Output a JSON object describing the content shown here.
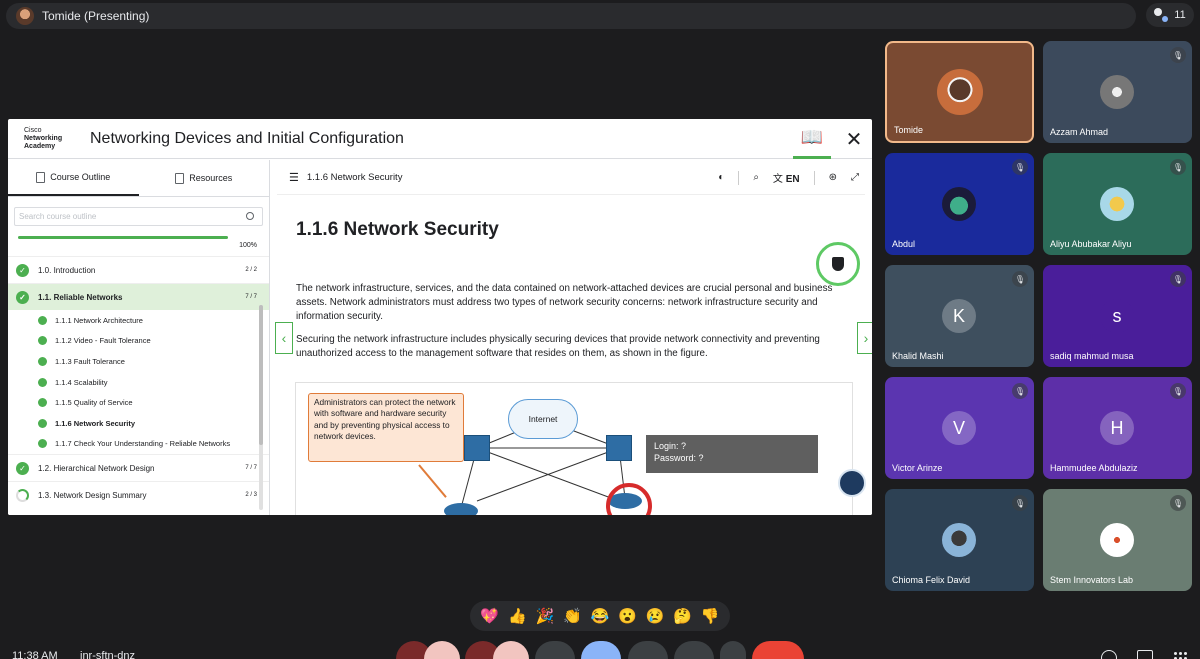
{
  "meeting": {
    "presenter_label": "Tomide (Presenting)",
    "participant_count": "11",
    "clock": "11:38 AM",
    "code": "jnr-sftn-dnz"
  },
  "share": {
    "logo": [
      "Cisco",
      "Networking",
      "Academy"
    ],
    "course_title": "Networking Devices and Initial Configuration",
    "tabs": [
      {
        "label": "Course Outline"
      },
      {
        "label": "Resources"
      }
    ],
    "search_placeholder": "Search course outline",
    "progress": {
      "percent_label": "100%",
      "value": 1.0
    },
    "outline": [
      {
        "label": "1.0. Introduction",
        "count": "2 / 2"
      },
      {
        "label": "1.1. Reliable Networks",
        "count": "7 / 7"
      },
      {
        "label": "1.2. Hierarchical Network Design",
        "count": "7 / 7"
      },
      {
        "label": "1.3. Network Design Summary",
        "count": "2 / 3"
      }
    ],
    "sub_items": [
      "1.1.1 Network Architecture",
      "1.1.2 Video - Fault Tolerance",
      "1.1.3 Fault Tolerance",
      "1.1.4 Scalability",
      "1.1.5 Quality of Service",
      "1.1.6 Network Security",
      "1.1.7 Check Your Understanding - Reliable Networks"
    ],
    "breadcrumb": "1.1.6 Network Security",
    "lang": "EN",
    "heading": "1.1.6 Network Security",
    "paragraph1": "The network infrastructure, services, and the data contained on network-attached devices are crucial personal and business assets. Network administrators must address two types of network security concerns: network infrastructure security and information security.",
    "paragraph2": "Securing the network infrastructure includes physically securing devices that provide network connectivity and preventing unauthorized access to the management software that resides on them, as shown in the figure.",
    "figure": {
      "callout": "Administrators can protect the network with software and hardware security and by preventing physical access to network devices.",
      "cloud_label": "Internet",
      "login_line1": "Login: ?",
      "login_line2": "Password: ?"
    }
  },
  "participants": [
    {
      "name": "Tomide"
    },
    {
      "name": "Azzam Ahmad"
    },
    {
      "name": "Abdul"
    },
    {
      "name": "Aliyu Abubakar Aliyu"
    },
    {
      "name": "Khalid Mashi",
      "initial": "K"
    },
    {
      "name": "sadiq mahmud musa",
      "initial": "s"
    },
    {
      "name": "Victor Arinze",
      "initial": "V"
    },
    {
      "name": "Hammudee Abdulaziz",
      "initial": "H"
    },
    {
      "name": "Chioma Felix David"
    },
    {
      "name": "Stem Innovators Lab"
    }
  ],
  "reactions": [
    "💖",
    "👍",
    "🎉",
    "👏",
    "😂",
    "😮",
    "😢",
    "🤔",
    "👎"
  ],
  "icons": {
    "book": "open-book-icon",
    "close": "close-icon",
    "menu": "menu-collapse-icon",
    "dark_mode": "dark-mode-icon",
    "search": "search-icon",
    "translate": "translate-icon",
    "accessibility": "accessibility-icon",
    "fullscreen": "fullscreen-icon",
    "shield": "shield-icon"
  },
  "colors": {
    "accent_green": "#4caf50",
    "end_call_red": "#ea4335",
    "muted_red": "#f2c5c0"
  }
}
